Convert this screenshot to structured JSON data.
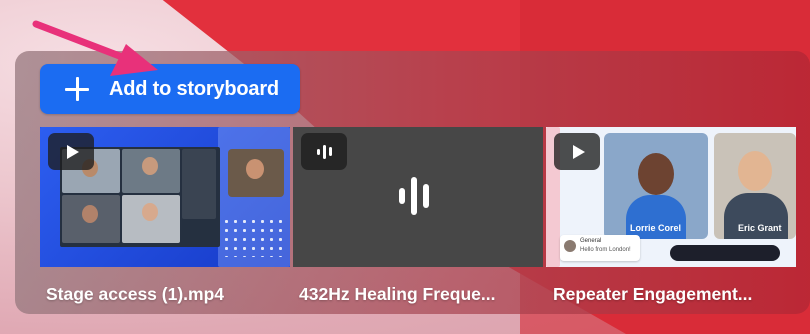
{
  "add_button": {
    "label": "Add to storyboard"
  },
  "media": [
    {
      "type": "video",
      "title": "Stage access (1).mp4",
      "badge_icon": "play-icon"
    },
    {
      "type": "audio",
      "title": "432Hz Healing Freque...",
      "badge_icon": "audio-wave-icon"
    },
    {
      "type": "video",
      "title": "Repeater Engagement...",
      "badge_icon": "play-icon"
    }
  ],
  "thumbnail_text": {
    "person_left": "Lorrie Corel",
    "person_right": "Eric Grant",
    "chat_line_1": "General",
    "chat_line_2": "Hello from London!"
  },
  "colors": {
    "accent_button": "#1b6cf2",
    "pointer_arrow": "#e8317a",
    "background_red": "#e2303d"
  }
}
